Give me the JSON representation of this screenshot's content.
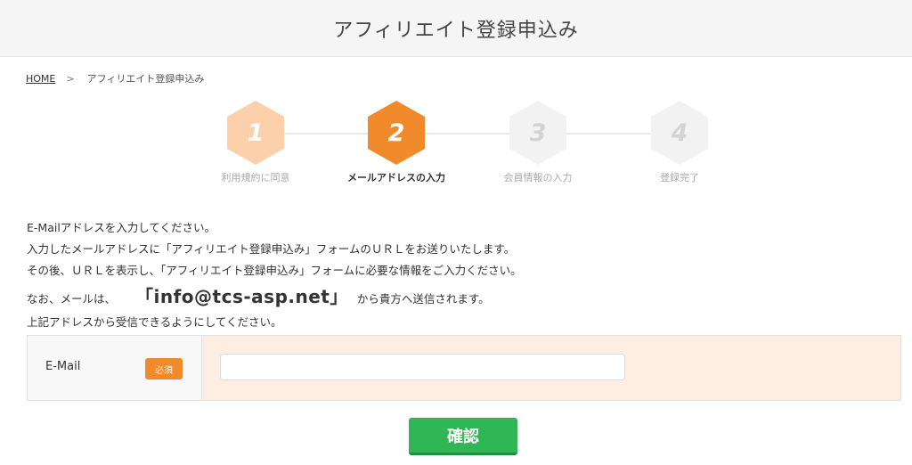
{
  "header": {
    "title": "アフィリエイト登録申込み"
  },
  "breadcrumb": {
    "home": "HOME",
    "separator": ">",
    "current": "アフィリエイト登録申込み"
  },
  "steps": [
    {
      "number": "1",
      "label": "利用規約に同意",
      "state": "done"
    },
    {
      "number": "2",
      "label": "メールアドレスの入力",
      "state": "active"
    },
    {
      "number": "3",
      "label": "会員情報の入力",
      "state": "todo"
    },
    {
      "number": "4",
      "label": "登録完了",
      "state": "todo"
    }
  ],
  "intro": {
    "line1": "E-Mailアドレスを入力してください。",
    "line2": "入力したメールアドレスに「アフィリエイト登録申込み」フォームのＵＲＬをお送りいたします。",
    "line3": "その後、ＵＲＬを表示し、「アフィリエイト登録申込み」フォームに必要な情報をご入力ください。",
    "line4_prefix": "なお、メールは、",
    "sender_email": "「info@tcs-asp.net」",
    "line4_suffix": "から貴方へ送信されます。",
    "line5": "上記アドレスから受信できるようにしてください。"
  },
  "form": {
    "email_label": "E-Mail",
    "required_badge": "必須",
    "email_value": "",
    "email_placeholder": ""
  },
  "confirm_button": "確認",
  "colors": {
    "accent": "#f08a2a",
    "step_done": "#fcd0ab",
    "step_todo": "#f2f2f2",
    "input_cell_bg": "#fdeee3",
    "confirm_green": "#2fb755"
  }
}
